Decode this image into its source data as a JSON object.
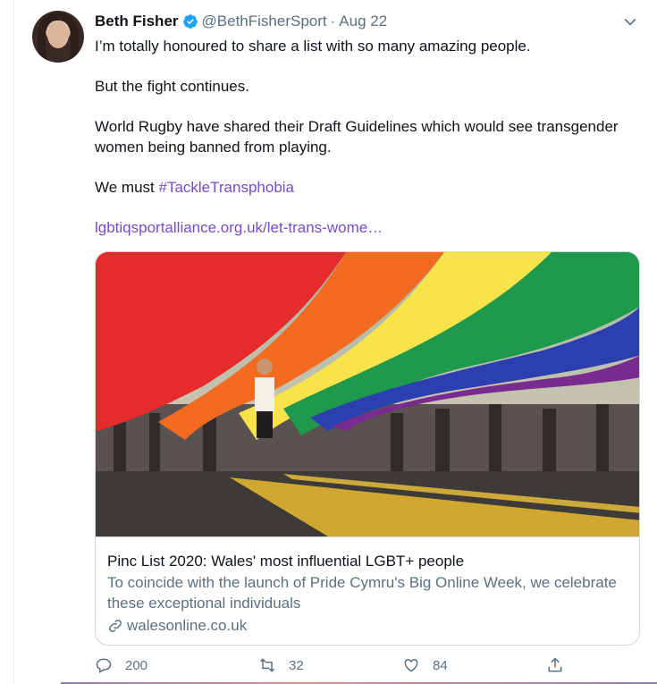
{
  "tweet": {
    "author_name": "Beth Fisher",
    "handle": "@BethFisherSport",
    "separator": "·",
    "date": "Aug 22",
    "paragraphs": [
      "I’m totally honoured to share a list with so many amazing people.",
      "But the fight continues.",
      "World Rugby have shared their Draft Guidelines which would see transgender women being banned from playing."
    ],
    "we_must": "We must ",
    "hashtag": "#TackleTransphobia",
    "link": "lgbtiqsportalliance.org.uk/let-trans-wome…"
  },
  "card": {
    "title": "Pinc List 2020: Wales' most influential LGBT+ people",
    "description": "To coincide with the launch of Pride Cymru's Big Online Week, we celebrate these exceptional individuals",
    "domain": "walesonline.co.uk",
    "image_icon": "pride-flag-crowd-photo"
  },
  "actions": {
    "reply_count": "200",
    "retweet_count": "32",
    "like_count": "84"
  },
  "icons": {
    "verified": "verified-badge-icon",
    "more": "chevron-down-icon",
    "link": "link-icon",
    "reply": "reply-icon",
    "retweet": "retweet-icon",
    "like": "heart-icon",
    "share": "share-icon"
  },
  "colors": {
    "link": "#794bc4",
    "secondary_text": "#5b7083",
    "verified": "#1da1f2",
    "border": "#cfd9de"
  }
}
